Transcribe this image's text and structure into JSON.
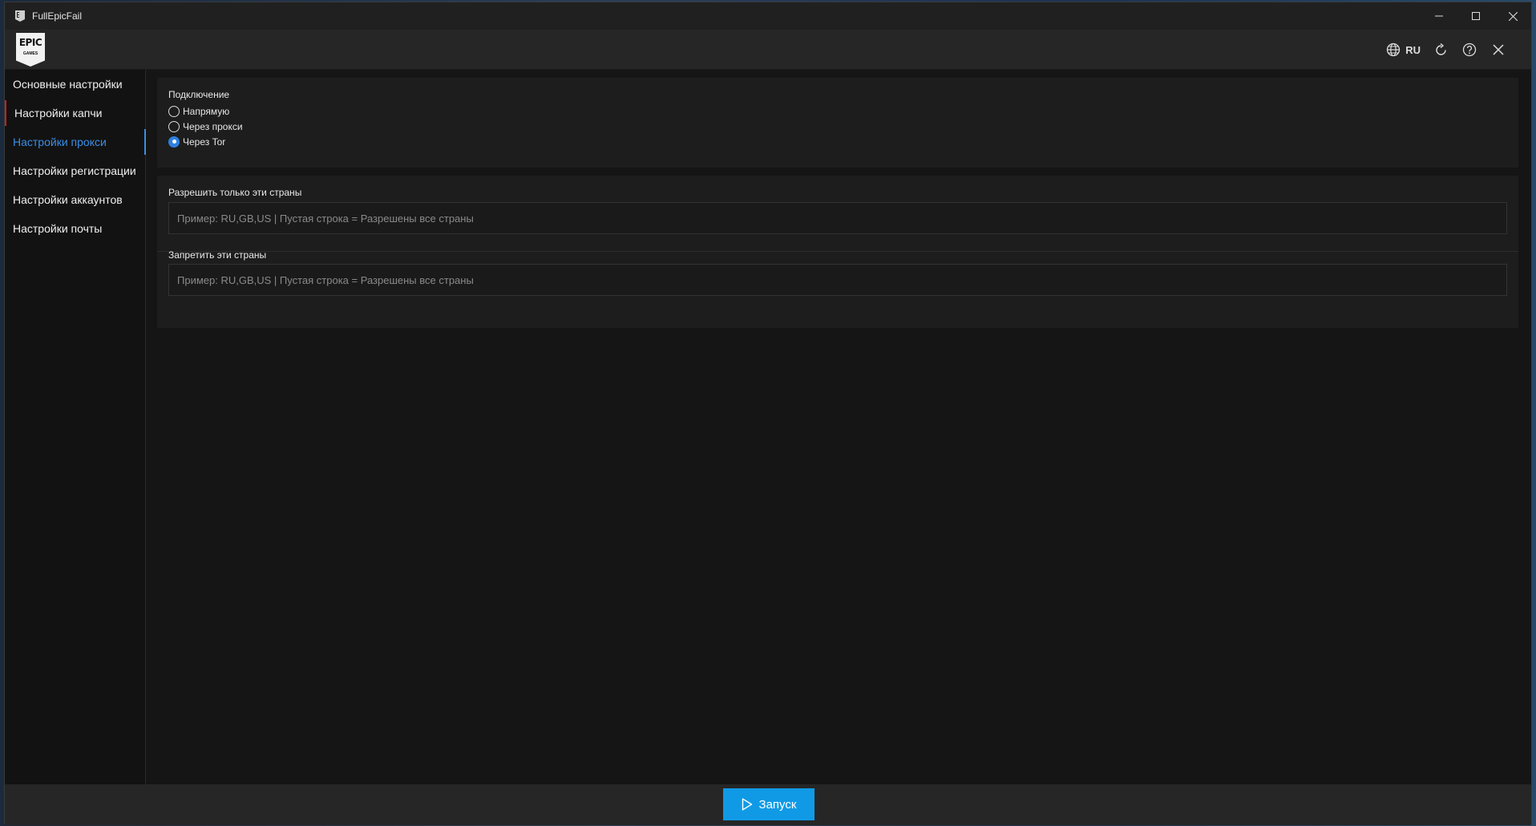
{
  "window": {
    "title": "FullEpicFail",
    "controls": {
      "minimize": "—",
      "maximize": "☐",
      "close": "✕"
    }
  },
  "header": {
    "logo_top": "EPIC",
    "logo_bottom": "GAMES",
    "language": "RU",
    "icons": [
      "globe-icon",
      "refresh-icon",
      "help-icon",
      "close-icon"
    ]
  },
  "sidebar": {
    "items": [
      {
        "label": "Основные настройки"
      },
      {
        "label": "Настройки капчи"
      },
      {
        "label": "Настройки прокси"
      },
      {
        "label": "Настройки регистрации"
      },
      {
        "label": "Настройки аккаунтов"
      },
      {
        "label": "Настройки почты"
      }
    ],
    "active_index": 2
  },
  "connection": {
    "label": "Подключение",
    "options": [
      {
        "label": "Напрямую",
        "checked": false
      },
      {
        "label": "Через прокси",
        "checked": false
      },
      {
        "label": "Через Tor",
        "checked": true
      }
    ]
  },
  "countries": {
    "allow_label": "Разрешить только эти страны",
    "allow_placeholder": "Пример: RU,GB,US | Пустая строка = Разрешены все страны",
    "allow_value": "",
    "deny_label": "Запретить эти страны",
    "deny_placeholder": "Пример: RU,GB,US | Пустая строка = Разрешены все страны",
    "deny_value": ""
  },
  "footer": {
    "run_label": "Запуск"
  },
  "colors": {
    "accent": "#109ae6",
    "active_nav": "#3a8ee6",
    "flag": "#c82020"
  }
}
